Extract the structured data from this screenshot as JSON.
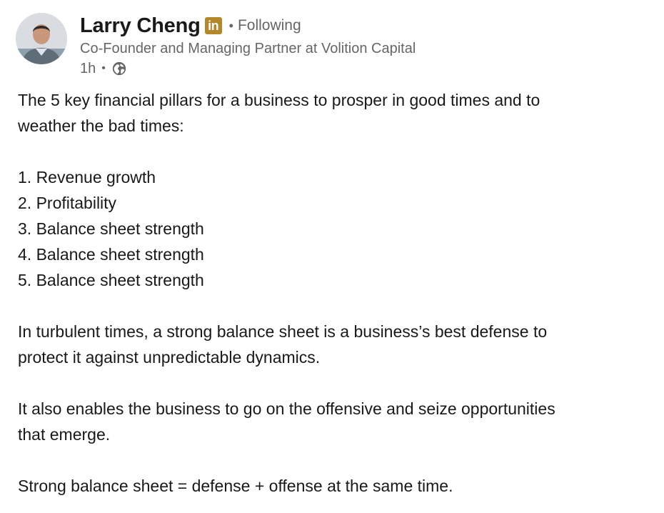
{
  "author": {
    "name": "Larry Cheng",
    "badge_label": "in",
    "follow_status": "Following",
    "separator": "•",
    "headline": "Co-Founder and Managing Partner at Volition Capital",
    "timestamp": "1h",
    "visibility_icon": "globe-icon",
    "avatar_icon": "profile-photo"
  },
  "post": {
    "intro_line_1": "The 5 key financial pillars for a business to prosper in good times and to",
    "intro_line_2": "weather the bad times:",
    "list": [
      "1. Revenue growth",
      "2. Profitability",
      "3. Balance sheet strength",
      "4. Balance sheet strength",
      "5. Balance sheet strength"
    ],
    "para2_line_1": "In turbulent times, a strong balance sheet is a business’s best defense to",
    "para2_line_2": "protect it against unpredictable dynamics.",
    "para3_line_1": "It also enables the business to go on the offensive and seize opportunities",
    "para3_line_2": "that emerge.",
    "para4_line_1": "Strong balance sheet = defense + offense at the same time."
  },
  "colors": {
    "badge": "#b4872a",
    "muted_text": "#666666",
    "body_text": "#191919"
  }
}
